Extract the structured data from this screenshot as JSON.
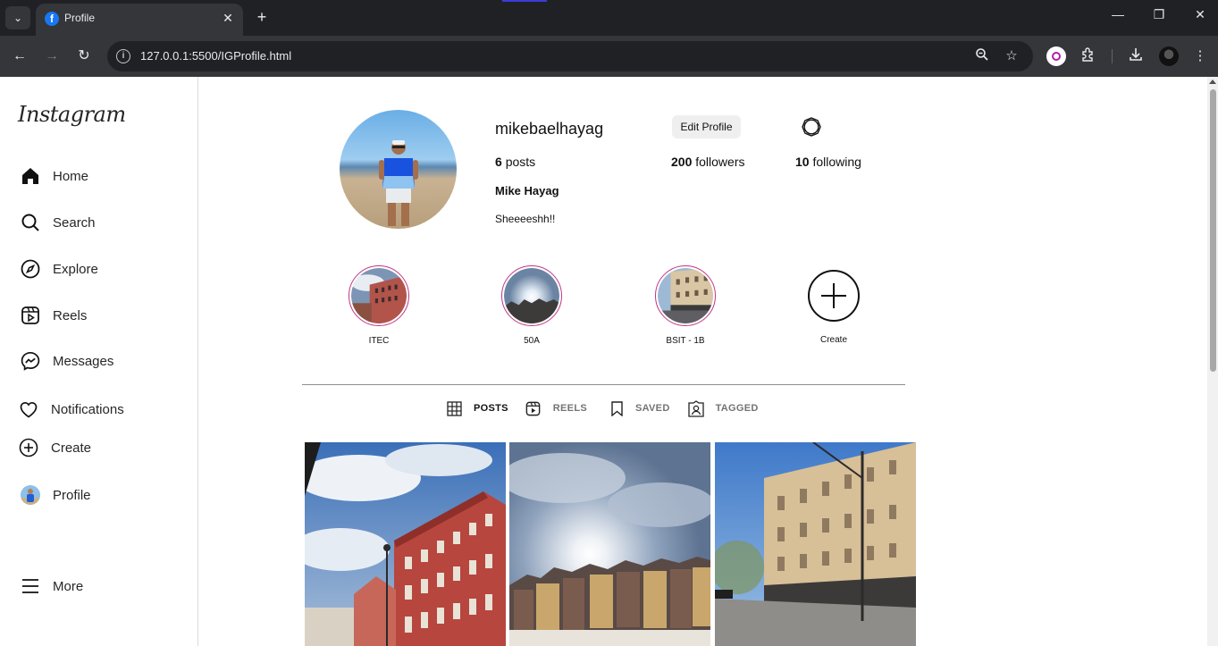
{
  "browser": {
    "tab_title": "Profile",
    "tab_close": "✕",
    "new_tab": "+",
    "url": "127.0.0.1:5500/IGProfile.html",
    "window_controls": [
      "—",
      "❐",
      "✕"
    ]
  },
  "sidebar": {
    "logo": "Instagram",
    "items": [
      {
        "label": "Home",
        "icon": "home-icon"
      },
      {
        "label": "Search",
        "icon": "search-icon"
      },
      {
        "label": "Explore",
        "icon": "compass-icon"
      },
      {
        "label": "Reels",
        "icon": "reels-icon"
      },
      {
        "label": "Messages",
        "icon": "messenger-icon"
      },
      {
        "label": "Notifications",
        "icon": "heart-icon"
      },
      {
        "label": "Create",
        "icon": "plus-circle-icon"
      },
      {
        "label": "Profile",
        "icon": "avatar-icon"
      },
      {
        "label": "More",
        "icon": "menu-icon"
      }
    ]
  },
  "profile": {
    "username": "mikebaelhayag",
    "edit_button": "Edit Profile",
    "posts_count": "6",
    "posts_label": "posts",
    "followers_count": "200",
    "followers_label": "followers",
    "following_count": "10",
    "following_label": "following",
    "full_name": "Mike Hayag",
    "bio": "Sheeeeshh!!"
  },
  "highlights": [
    {
      "label": "ITEC"
    },
    {
      "label": "50A"
    },
    {
      "label": "BSIT - 1B"
    },
    {
      "label": "Create"
    }
  ],
  "tabs": [
    {
      "label": "POSTS",
      "icon": "grid-icon",
      "active": true
    },
    {
      "label": "REELS",
      "icon": "reels-icon",
      "active": false
    },
    {
      "label": "SAVED",
      "icon": "bookmark-icon",
      "active": false
    },
    {
      "label": "TAGGED",
      "icon": "tagged-icon",
      "active": false
    }
  ],
  "colors": {
    "highlight_ring": "#c13584",
    "browser_frame": "#202124",
    "toolbar": "#35363a"
  }
}
